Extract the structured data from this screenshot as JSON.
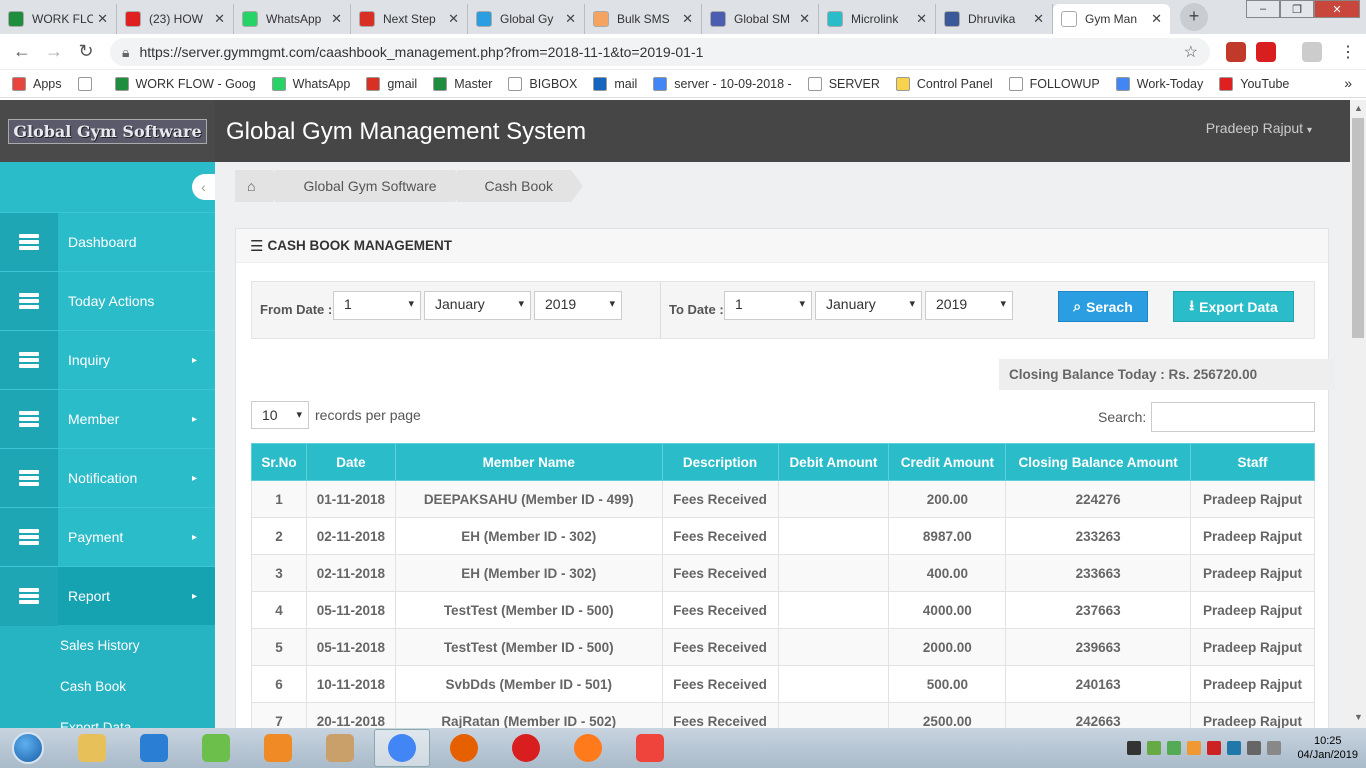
{
  "browser": {
    "tabs": [
      {
        "title": "WORK FLO",
        "color": "#1e8e3e"
      },
      {
        "title": "(23) HOW",
        "color": "#e02020"
      },
      {
        "title": "WhatsApp",
        "color": "#25d366"
      },
      {
        "title": "Next Step",
        "color": "#d93025"
      },
      {
        "title": "Global Gy",
        "color": "#2a9ee0"
      },
      {
        "title": "Bulk SMS",
        "color": "#f4a460"
      },
      {
        "title": "Global SM",
        "color": "#4a5db0"
      },
      {
        "title": "Microlink",
        "color": "#2bbcca"
      },
      {
        "title": "Dhruvika",
        "color": "#3b5998"
      },
      {
        "title": "Gym Man",
        "color": "#ffffff"
      }
    ],
    "new_tab": "+",
    "url": "https://server.gymmgmt.com/caashbook_management.php?from=2018-11-1&to=2019-01-1",
    "bookmarks": [
      {
        "label": "Apps",
        "color": "#e8453c"
      },
      {
        "label": "",
        "color": "#ffffff"
      },
      {
        "label": "WORK FLOW - Goog",
        "color": "#1e8e3e"
      },
      {
        "label": "WhatsApp",
        "color": "#25d366"
      },
      {
        "label": "gmail",
        "color": "#d93025"
      },
      {
        "label": "Master",
        "color": "#1e8e3e"
      },
      {
        "label": "BIGBOX",
        "color": "#ffffff"
      },
      {
        "label": "mail",
        "color": "#1565c0"
      },
      {
        "label": "server - 10-09-2018 -",
        "color": "#4285f4"
      },
      {
        "label": "SERVER",
        "color": "#ffffff"
      },
      {
        "label": "Control Panel",
        "color": "#f7d44c"
      },
      {
        "label": "FOLLOWUP",
        "color": "#ffffff"
      },
      {
        "label": "Work-Today",
        "color": "#4285f4"
      },
      {
        "label": "YouTube",
        "color": "#e02020"
      }
    ],
    "more": "»"
  },
  "header": {
    "logo": "Global Gym Software",
    "title": "Global Gym Management System",
    "user": "Pradeep Rajput"
  },
  "sidebar": {
    "items": [
      {
        "label": "Dashboard",
        "arrow": ""
      },
      {
        "label": "Today Actions",
        "arrow": ""
      },
      {
        "label": "Inquiry",
        "arrow": "▸"
      },
      {
        "label": "Member",
        "arrow": "▸"
      },
      {
        "label": "Notification",
        "arrow": "▸"
      },
      {
        "label": "Payment",
        "arrow": "▸"
      },
      {
        "label": "Report",
        "arrow": "▸"
      }
    ],
    "sub_items": [
      "Sales History",
      "Cash Book",
      "Export Data"
    ]
  },
  "breadcrumb": {
    "home": "⌂",
    "items": [
      "Global Gym Software",
      "Cash Book"
    ]
  },
  "panel": {
    "title": "CASH BOOK MANAGEMENT",
    "from_label": "From Date :",
    "to_label": "To Date :",
    "from": {
      "day": "1",
      "month": "January",
      "year": "2019"
    },
    "to": {
      "day": "1",
      "month": "January",
      "year": "2019"
    },
    "search_button": "Serach",
    "export_button": "Export Data",
    "closing_balance": "Closing Balance Today : Rs. 256720.00",
    "page_size": "10",
    "page_size_label": "records per page",
    "search_label": "Search:"
  },
  "table": {
    "columns": [
      "Sr.No",
      "Date",
      "Member Name",
      "Description",
      "Debit Amount",
      "Credit Amount",
      "Closing Balance Amount",
      "Staff"
    ],
    "rows": [
      [
        "1",
        "01-11-2018",
        "DEEPAKSAHU (Member ID - 499)",
        "Fees Received",
        "",
        "200.00",
        "224276",
        "Pradeep Rajput"
      ],
      [
        "2",
        "02-11-2018",
        "EH (Member ID - 302)",
        "Fees Received",
        "",
        "8987.00",
        "233263",
        "Pradeep Rajput"
      ],
      [
        "3",
        "02-11-2018",
        "EH (Member ID - 302)",
        "Fees Received",
        "",
        "400.00",
        "233663",
        "Pradeep Rajput"
      ],
      [
        "4",
        "05-11-2018",
        "TestTest (Member ID - 500)",
        "Fees Received",
        "",
        "4000.00",
        "237663",
        "Pradeep Rajput"
      ],
      [
        "5",
        "05-11-2018",
        "TestTest (Member ID - 500)",
        "Fees Received",
        "",
        "2000.00",
        "239663",
        "Pradeep Rajput"
      ],
      [
        "6",
        "10-11-2018",
        "SvbDds (Member ID - 501)",
        "Fees Received",
        "",
        "500.00",
        "240163",
        "Pradeep Rajput"
      ],
      [
        "7",
        "20-11-2018",
        "RajRatan (Member ID - 502)",
        "Fees Received",
        "",
        "2500.00",
        "242663",
        "Pradeep Rajput"
      ]
    ]
  },
  "taskbar": {
    "apps": [
      {
        "name": "explorer",
        "color": "#e8c05a"
      },
      {
        "name": "ie",
        "color": "#2a7fd4"
      },
      {
        "name": "app-green",
        "color": "#6bbf4a"
      },
      {
        "name": "media",
        "color": "#f08a24"
      },
      {
        "name": "paint",
        "color": "#c9a06a"
      },
      {
        "name": "chrome",
        "color": "#4285f4"
      },
      {
        "name": "firefox-dev",
        "color": "#e66000"
      },
      {
        "name": "opera",
        "color": "#d81e1e"
      },
      {
        "name": "firefox",
        "color": "#ff7a1a"
      },
      {
        "name": "anydesk",
        "color": "#ef443b"
      }
    ],
    "time": "10:25",
    "date": "04/Jan/2019"
  }
}
